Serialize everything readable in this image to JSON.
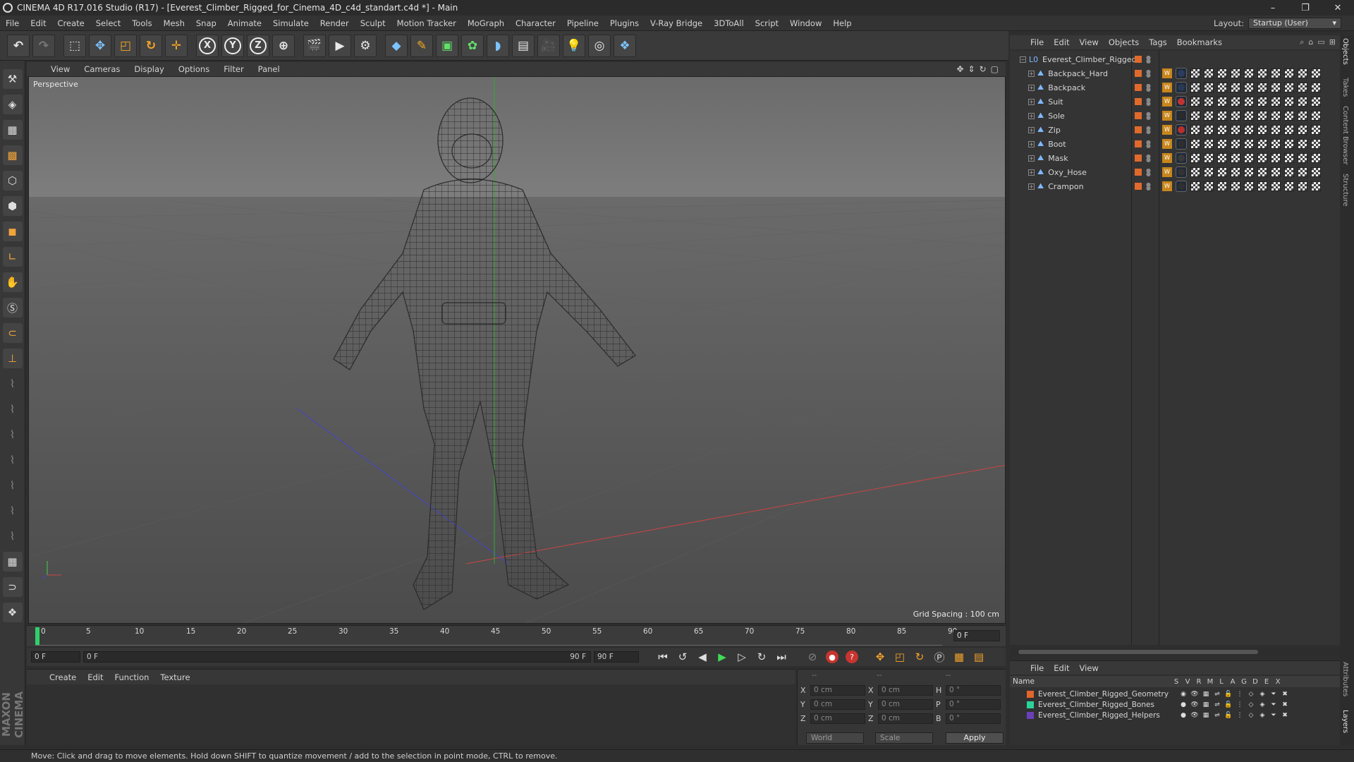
{
  "window": {
    "title": "CINEMA 4D R17.016 Studio (R17) - [Everest_Climber_Rigged_for_Cinema_4D_c4d_standart.c4d *] - Main",
    "minimize": "–",
    "restore": "❐",
    "close": "✕"
  },
  "menubar": {
    "items": [
      "File",
      "Edit",
      "Create",
      "Select",
      "Tools",
      "Mesh",
      "Snap",
      "Animate",
      "Simulate",
      "Render",
      "Sculpt",
      "Motion Tracker",
      "MoGraph",
      "Character",
      "Pipeline",
      "Plugins",
      "V-Ray Bridge",
      "3DToAll",
      "Script",
      "Window",
      "Help"
    ],
    "layout_label": "Layout:",
    "layout_value": "Startup (User)"
  },
  "viewport": {
    "menu": [
      "View",
      "Cameras",
      "Display",
      "Options",
      "Filter",
      "Panel"
    ],
    "label": "Perspective",
    "grid_spacing": "Grid Spacing : 100 cm"
  },
  "timeline": {
    "ticks": [
      "0",
      "5",
      "10",
      "15",
      "20",
      "25",
      "30",
      "35",
      "40",
      "45",
      "50",
      "55",
      "60",
      "65",
      "70",
      "75",
      "80",
      "85",
      "90"
    ],
    "current_frame": "0 F"
  },
  "transport": {
    "start_field": "0 F",
    "range_start": "0 F",
    "range_end": "90 F",
    "end_field": "90 F"
  },
  "material_manager": {
    "menu": [
      "Create",
      "Edit",
      "Function",
      "Texture"
    ]
  },
  "coordinates": {
    "header_dashes": [
      "--",
      "--",
      "--"
    ],
    "rows": [
      {
        "a1": "X",
        "v1": "0 cm",
        "a2": "X",
        "v2": "0 cm",
        "a3": "H",
        "v3": "0 °"
      },
      {
        "a1": "Y",
        "v1": "0 cm",
        "a2": "Y",
        "v2": "0 cm",
        "a3": "P",
        "v3": "0 °"
      },
      {
        "a1": "Z",
        "v1": "0 cm",
        "a2": "Z",
        "v2": "0 cm",
        "a3": "B",
        "v3": "0 °"
      }
    ],
    "mode": "World",
    "type": "Scale",
    "apply": "Apply"
  },
  "object_manager": {
    "menu": [
      "File",
      "Edit",
      "View",
      "Objects",
      "Tags",
      "Bookmarks"
    ],
    "root": "Everest_Climber_Rigged",
    "objects": [
      {
        "name": "Backpack_Hard",
        "mat_color": "#2c3d5e"
      },
      {
        "name": "Backpack",
        "mat_color": "#2a3a55"
      },
      {
        "name": "Suit",
        "mat_color": "#c0342f"
      },
      {
        "name": "Sole",
        "mat_color": "#2b2b2b"
      },
      {
        "name": "Zip",
        "mat_color": "#b8302c"
      },
      {
        "name": "Boot",
        "mat_color": "#2e2e2e"
      },
      {
        "name": "Mask",
        "mat_color": "#3a3a3a"
      },
      {
        "name": "Oxy_Hose",
        "mat_color": "#333333"
      },
      {
        "name": "Crampon",
        "mat_color": "#303030"
      }
    ]
  },
  "layer_manager": {
    "menu": [
      "File",
      "Edit",
      "View"
    ],
    "columns": [
      "S",
      "V",
      "R",
      "M",
      "L",
      "A",
      "G",
      "D",
      "E",
      "X"
    ],
    "name_header": "Name",
    "layers": [
      {
        "name": "Everest_Climber_Rigged_Geometry",
        "color": "#e0662a"
      },
      {
        "name": "Everest_Climber_Rigged_Bones",
        "color": "#2bd39b"
      },
      {
        "name": "Everest_Climber_Rigged_Helpers",
        "color": "#6a3fb8"
      }
    ]
  },
  "right_tabs": [
    "Objects",
    "Takes",
    "Content Browser",
    "Structure",
    "Attributes",
    "Layers"
  ],
  "status": "Move: Click and drag to move elements. Hold down SHIFT to quantize movement / add to the selection in point mode, CTRL to remove.",
  "branding": "MAXON CINEMA 4D"
}
